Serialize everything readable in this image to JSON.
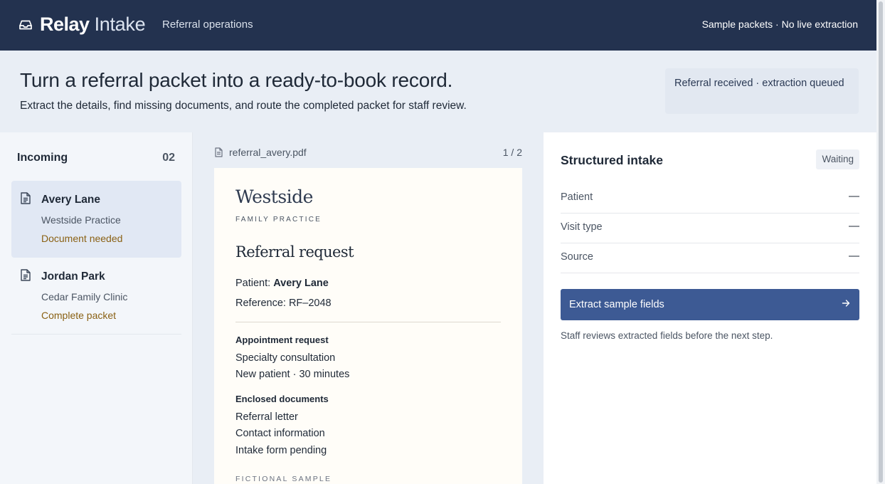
{
  "header": {
    "brand_name": "Relay",
    "brand_sub": "Intake",
    "nav_link": "Referral operations",
    "status": "Sample packets · No live extraction"
  },
  "hero": {
    "title": "Turn a referral packet into a ready-to-book record.",
    "subtitle": "Extract the details, find missing documents, and route the completed packet for staff review.",
    "badge": "Referral received · extraction queued"
  },
  "sidebar": {
    "heading": "Incoming",
    "count": "02",
    "items": [
      {
        "name": "Avery Lane",
        "practice": "Westside Practice",
        "status": "Document needed"
      },
      {
        "name": "Jordan Park",
        "practice": "Cedar Family Clinic",
        "status": "Complete packet"
      }
    ]
  },
  "viewer": {
    "filename": "referral_avery.pdf",
    "page": "1 / 2",
    "document": {
      "logo": "Westside",
      "logo_sub": "FAMILY PRACTICE",
      "title": "Referral request",
      "patient_label": "Patient:",
      "patient_name": "Avery Lane",
      "reference": "Reference: RF–2048",
      "appointment_heading": "Appointment request",
      "appointment_lines": [
        "Specialty consultation",
        "New patient · 30 minutes"
      ],
      "enclosed_heading": "Enclosed documents",
      "enclosed_lines": [
        "Referral letter",
        "Contact information",
        "Intake form pending"
      ],
      "footer": "FICTIONAL SAMPLE"
    }
  },
  "panel": {
    "title": "Structured intake",
    "badge": "Waiting",
    "fields": [
      {
        "label": "Patient",
        "value": "—"
      },
      {
        "label": "Visit type",
        "value": "—"
      },
      {
        "label": "Source",
        "value": "—"
      }
    ],
    "button_label": "Extract sample fields",
    "hint": "Staff reviews extracted fields before the next step."
  },
  "colors": {
    "header_bg": "#23324f",
    "accent": "#3d5a94",
    "status_warning": "#8a6114",
    "page_bg": "#e9eef5"
  },
  "icons": {
    "brand": "inbox-icon",
    "card": "document-icon",
    "file": "file-icon",
    "button": "arrow-right-icon"
  }
}
